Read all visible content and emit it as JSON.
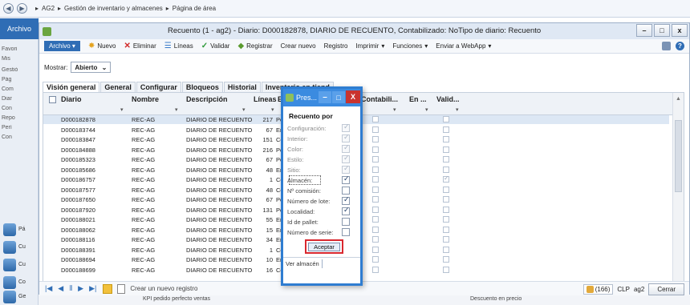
{
  "address_bar": {
    "crumbs": [
      "AG2",
      "Gestión de inventario y almacenes",
      "Página de área"
    ]
  },
  "left_panel": {
    "archivo": "Archivo",
    "items": [
      "Favori",
      "Mis",
      "Gestió",
      "Pág",
      "Com",
      "Diar",
      "Con",
      "Repo",
      "Perí",
      "Con"
    ],
    "big_items": [
      "Pá",
      "Cu",
      "Cu",
      "Co",
      "Ge"
    ]
  },
  "window": {
    "title": "Recuento (1 - ag2) - Diario: D000182878, DIARIO DE RECUENTO, Contabilizado: NoTipo de diario: Recuento",
    "controls": {
      "minimize": "–",
      "maximize": "□",
      "close": "x"
    }
  },
  "action_bar": {
    "archivo": "Archivo",
    "nuevo": "Nuevo",
    "eliminar": "Eliminar",
    "lineas": "Líneas",
    "validar": "Validar",
    "registrar": "Registrar",
    "crear_nuevo": "Crear nuevo",
    "registro": "Registro",
    "imprimir": "Imprimir",
    "funciones": "Funciones",
    "enviar": "Enviar a WebApp"
  },
  "filter": {
    "label": "Mostrar:",
    "value": "Abierto"
  },
  "tabs": [
    "Visión general",
    "General",
    "Configurar",
    "Bloqueos",
    "Historial",
    "Inventario en tiend"
  ],
  "grid": {
    "columns": [
      "Diario",
      "Nombre",
      "Descripción",
      "Líneas",
      "Es",
      "Contabili...",
      "En ...",
      "Valid..."
    ],
    "rows": [
      {
        "diario": "D000182878",
        "nombre": "REC-AG",
        "desc": "DIARIO DE RECUENTO",
        "lineas": "217",
        "es": "Pen",
        "valid": false
      },
      {
        "diario": "D000183744",
        "nombre": "REC-AG",
        "desc": "DIARIO DE RECUENTO",
        "lineas": "67",
        "es": "Env",
        "valid": false
      },
      {
        "diario": "D000183847",
        "nombre": "REC-AG",
        "desc": "DIARIO DE RECUENTO",
        "lineas": "151",
        "es": "Con",
        "valid": false
      },
      {
        "diario": "D000184888",
        "nombre": "REC-AG",
        "desc": "DIARIO DE RECUENTO",
        "lineas": "216",
        "es": "Pen",
        "valid": false
      },
      {
        "diario": "D000185323",
        "nombre": "REC-AG",
        "desc": "DIARIO DE RECUENTO",
        "lineas": "67",
        "es": "Pen",
        "valid": false
      },
      {
        "diario": "D000185686",
        "nombre": "REC-AG",
        "desc": "DIARIO DE RECUENTO",
        "lineas": "48",
        "es": "Env",
        "valid": false
      },
      {
        "diario": "D000186757",
        "nombre": "REC-AG",
        "desc": "DIARIO DE RECUENTO",
        "lineas": "1",
        "es": "Con",
        "valid": true
      },
      {
        "diario": "D000187577",
        "nombre": "REC-AG",
        "desc": "DIARIO DE RECUENTO",
        "lineas": "48",
        "es": "Con",
        "valid": false
      },
      {
        "diario": "D000187650",
        "nombre": "REC-AG",
        "desc": "DIARIO DE RECUENTO",
        "lineas": "67",
        "es": "Pen",
        "valid": false
      },
      {
        "diario": "D000187920",
        "nombre": "REC-AG",
        "desc": "DIARIO DE RECUENTO",
        "lineas": "131",
        "es": "Pen",
        "valid": false
      },
      {
        "diario": "D000188021",
        "nombre": "REC-AG",
        "desc": "DIARIO DE RECUENTO",
        "lineas": "55",
        "es": "Env",
        "valid": false
      },
      {
        "diario": "D000188062",
        "nombre": "REC-AG",
        "desc": "DIARIO DE RECUENTO",
        "lineas": "15",
        "es": "Env",
        "valid": false
      },
      {
        "diario": "D000188116",
        "nombre": "REC-AG",
        "desc": "DIARIO DE RECUENTO",
        "lineas": "34",
        "es": "Env",
        "valid": false
      },
      {
        "diario": "D000188391",
        "nombre": "REC-AG",
        "desc": "DIARIO DE RECUENTO",
        "lineas": "1",
        "es": "Con",
        "valid": false
      },
      {
        "diario": "D000188694",
        "nombre": "REC-AG",
        "desc": "DIARIO DE RECUENTO",
        "lineas": "10",
        "es": "Env",
        "valid": false
      },
      {
        "diario": "D000188699",
        "nombre": "REC-AG",
        "desc": "DIARIO DE RECUENTO",
        "lineas": "16",
        "es": "Con",
        "valid": false
      }
    ]
  },
  "nav_bar": {
    "new_record": "Crear un nuevo registro",
    "count": "(166)",
    "currency": "CLP",
    "company": "ag2",
    "close": "Cerrar"
  },
  "footer": {
    "left": "KPI pedido perfecto ventas",
    "right": "Descuento en precio"
  },
  "popup": {
    "title": "Pres...",
    "section": "Recuento por",
    "options": [
      {
        "label": "Configuración:",
        "checked": true,
        "enabled": false
      },
      {
        "label": "Interior:",
        "checked": true,
        "enabled": false
      },
      {
        "label": "Color:",
        "checked": true,
        "enabled": false
      },
      {
        "label": "Estilo:",
        "checked": true,
        "enabled": false
      },
      {
        "label": "Sitio:",
        "checked": true,
        "enabled": false
      },
      {
        "label": "Almacén:",
        "checked": true,
        "enabled": true
      },
      {
        "label": "Nº comisión:",
        "checked": false,
        "enabled": true
      },
      {
        "label": "Número de lote:",
        "checked": true,
        "enabled": true
      },
      {
        "label": "Localidad:",
        "checked": true,
        "enabled": true
      },
      {
        "label": "Id de pallet:",
        "checked": false,
        "enabled": true
      },
      {
        "label": "Número de serie:",
        "checked": false,
        "enabled": true
      }
    ],
    "accept": "Aceptar",
    "footer_link": "Ver almacén"
  }
}
